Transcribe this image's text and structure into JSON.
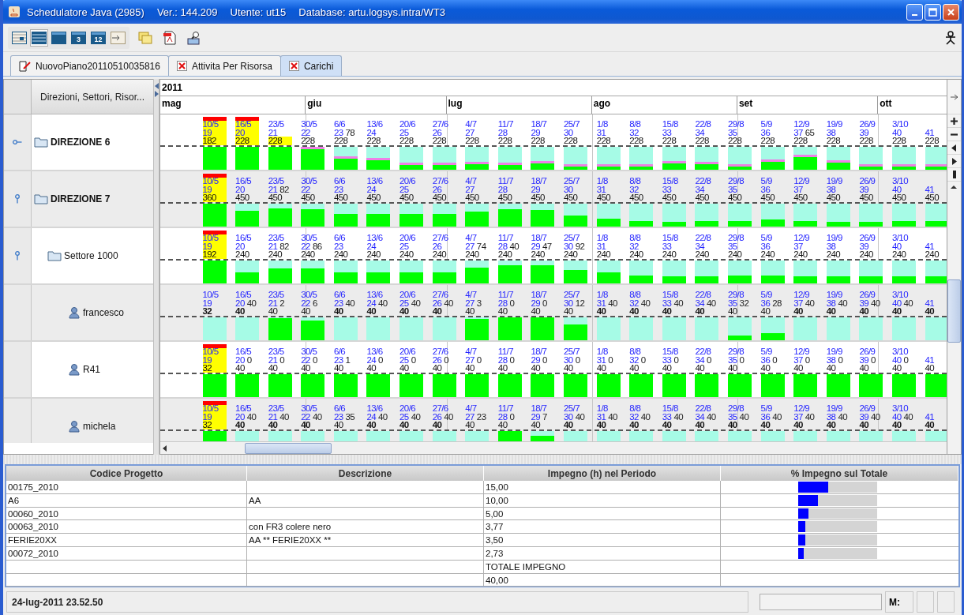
{
  "window": {
    "title_parts": [
      "Schedulatore Java (2985)",
      "Ver.: 144.209",
      "Utente: ut15",
      "Database: artu.logsys.intra/WT3"
    ]
  },
  "toolbar": {
    "view_buttons": [
      {
        "kind": "grid",
        "selected": false
      },
      {
        "kind": "rows",
        "selected": true
      },
      {
        "kind": "calendar",
        "selected": false
      },
      {
        "kind": "calendar",
        "label": "3",
        "selected": false
      },
      {
        "kind": "calendar",
        "label": "12",
        "selected": false
      },
      {
        "kind": "import",
        "selected": false
      }
    ],
    "tools": [
      {
        "kind": "notes"
      },
      {
        "kind": "pdf"
      },
      {
        "kind": "preview"
      }
    ]
  },
  "tabs": [
    {
      "label": "NuovoPiano20110510035816",
      "kind": "document",
      "selected": false
    },
    {
      "label": "Attivita Per Risorsa",
      "kind": "close",
      "selected": false
    },
    {
      "label": "Carichi",
      "kind": "close",
      "selected": true
    }
  ],
  "tree_header": "Direzioni, Settori, Risor...",
  "timeline": {
    "year": "2011",
    "months": [
      "mag",
      "giu",
      "lug",
      "ago",
      "set",
      "ott"
    ]
  },
  "rows": [
    {
      "label": "DIREZIONE 6",
      "kind": "direzione",
      "expanded": false,
      "cells": [
        {
          "date": "10/5",
          "week": "19",
          "capacity": "182",
          "bold": false,
          "overloaded": true,
          "warning": false,
          "marker": false
        },
        {
          "date": "16/5",
          "week": "20",
          "capacity": "228",
          "bold": false,
          "overloaded": true,
          "warning": false,
          "marker": false
        },
        {
          "date": "23/5",
          "week": "21",
          "capacity": "228",
          "bold": false,
          "overloaded": false,
          "warning": true,
          "marker": false
        },
        {
          "date": "30/5",
          "week": "22",
          "capacity": "228",
          "bold": false,
          "overloaded": false,
          "warning": false,
          "marker": true
        },
        {
          "date": "6/6",
          "week": "23",
          "load": "78",
          "capacity": "228",
          "bold": false,
          "overloaded": false,
          "warning": false,
          "marker": true
        },
        {
          "date": "13/6",
          "week": "24",
          "capacity": "228",
          "bold": false,
          "overloaded": false,
          "warning": false,
          "marker": true
        },
        {
          "date": "20/6",
          "week": "25",
          "capacity": "228",
          "bold": false,
          "overloaded": false,
          "warning": false,
          "marker": true
        },
        {
          "date": "27/6",
          "week": "26",
          "capacity": "228",
          "bold": false,
          "overloaded": false,
          "warning": false,
          "marker": true
        },
        {
          "date": "4/7",
          "week": "27",
          "capacity": "228",
          "bold": false,
          "overloaded": false,
          "warning": false,
          "marker": true
        },
        {
          "date": "11/7",
          "week": "28",
          "capacity": "228",
          "bold": false,
          "overloaded": false,
          "warning": false,
          "marker": true
        },
        {
          "date": "18/7",
          "week": "29",
          "capacity": "228",
          "bold": false,
          "overloaded": false,
          "warning": false,
          "marker": true
        },
        {
          "date": "25/7",
          "week": "30",
          "capacity": "228",
          "bold": false,
          "overloaded": false,
          "warning": false,
          "marker": true
        },
        {
          "date": "1/8",
          "week": "31",
          "capacity": "228",
          "bold": false,
          "overloaded": false,
          "warning": false,
          "marker": true
        },
        {
          "date": "8/8",
          "week": "32",
          "capacity": "228",
          "bold": false,
          "overloaded": false,
          "warning": false,
          "marker": true
        },
        {
          "date": "15/8",
          "week": "33",
          "capacity": "228",
          "bold": false,
          "overloaded": false,
          "warning": false,
          "marker": true
        },
        {
          "date": "22/8",
          "week": "34",
          "capacity": "228",
          "bold": false,
          "overloaded": false,
          "warning": false,
          "marker": true
        },
        {
          "date": "29/8",
          "week": "35",
          "capacity": "228",
          "bold": false,
          "overloaded": false,
          "warning": false,
          "marker": true
        },
        {
          "date": "5/9",
          "week": "36",
          "capacity": "228",
          "bold": false,
          "overloaded": false,
          "warning": false,
          "marker": true
        },
        {
          "date": "12/9",
          "week": "37",
          "load": "65",
          "capacity": "228",
          "bold": false,
          "overloaded": false,
          "warning": false,
          "marker": true
        },
        {
          "date": "19/9",
          "week": "38",
          "capacity": "228",
          "bold": false,
          "overloaded": false,
          "warning": false,
          "marker": true
        },
        {
          "date": "26/9",
          "week": "39",
          "capacity": "228",
          "bold": false,
          "overloaded": false,
          "warning": false,
          "marker": true
        },
        {
          "date": "3/10",
          "week": "40",
          "capacity": "228",
          "bold": false,
          "overloaded": false,
          "warning": false,
          "marker": true
        },
        {
          "week": "41",
          "capacity": "228",
          "bold": false,
          "overloaded": false,
          "warning": false,
          "marker": true
        }
      ]
    },
    {
      "label": "DIREZIONE 7",
      "kind": "direzione",
      "expanded": true,
      "cells": [
        {
          "date": "10/5",
          "week": "19",
          "capacity": "360",
          "bold": false,
          "overloaded": true,
          "warning": false,
          "marker": false
        },
        {
          "date": "16/5",
          "week": "20",
          "capacity": "450",
          "bold": false,
          "overloaded": false,
          "warning": false,
          "marker": false
        },
        {
          "date": "23/5",
          "week": "21",
          "load": "82",
          "capacity": "450",
          "bold": false,
          "overloaded": false,
          "warning": false,
          "marker": false
        },
        {
          "date": "30/5",
          "week": "22",
          "capacity": "450",
          "bold": false,
          "overloaded": false,
          "warning": false,
          "marker": false
        },
        {
          "date": "6/6",
          "week": "23",
          "capacity": "450",
          "bold": false,
          "overloaded": false,
          "warning": false,
          "marker": false
        },
        {
          "date": "13/6",
          "week": "24",
          "capacity": "450",
          "bold": false,
          "overloaded": false,
          "warning": false,
          "marker": false
        },
        {
          "date": "20/6",
          "week": "25",
          "capacity": "450",
          "bold": false,
          "overloaded": false,
          "warning": false,
          "marker": false
        },
        {
          "date": "27/6",
          "week": "26",
          "capacity": "450",
          "bold": false,
          "overloaded": false,
          "warning": false,
          "marker": false
        },
        {
          "date": "4/7",
          "week": "27",
          "capacity": "450",
          "bold": false,
          "overloaded": false,
          "warning": false,
          "marker": false
        },
        {
          "date": "11/7",
          "week": "28",
          "capacity": "450",
          "bold": false,
          "overloaded": false,
          "warning": false,
          "marker": false
        },
        {
          "date": "18/7",
          "week": "29",
          "capacity": "450",
          "bold": false,
          "overloaded": false,
          "warning": false,
          "marker": false
        },
        {
          "date": "25/7",
          "week": "30",
          "capacity": "450",
          "bold": false,
          "overloaded": false,
          "warning": false,
          "marker": false
        },
        {
          "date": "1/8",
          "week": "31",
          "capacity": "450",
          "bold": false,
          "overloaded": false,
          "warning": false,
          "marker": false
        },
        {
          "date": "8/8",
          "week": "32",
          "capacity": "450",
          "bold": false,
          "overloaded": false,
          "warning": false,
          "marker": false
        },
        {
          "date": "15/8",
          "week": "33",
          "capacity": "450",
          "bold": false,
          "overloaded": false,
          "warning": false,
          "marker": false
        },
        {
          "date": "22/8",
          "week": "34",
          "capacity": "450",
          "bold": false,
          "overloaded": false,
          "warning": false,
          "marker": false
        },
        {
          "date": "29/8",
          "week": "35",
          "capacity": "450",
          "bold": false,
          "overloaded": false,
          "warning": false,
          "marker": false
        },
        {
          "date": "5/9",
          "week": "36",
          "capacity": "450",
          "bold": false,
          "overloaded": false,
          "warning": false,
          "marker": false
        },
        {
          "date": "12/9",
          "week": "37",
          "capacity": "450",
          "bold": false,
          "overloaded": false,
          "warning": false,
          "marker": false
        },
        {
          "date": "19/9",
          "week": "38",
          "capacity": "450",
          "bold": false,
          "overloaded": false,
          "warning": false,
          "marker": false
        },
        {
          "date": "26/9",
          "week": "39",
          "capacity": "450",
          "bold": false,
          "overloaded": false,
          "warning": false,
          "marker": false
        },
        {
          "date": "3/10",
          "week": "40",
          "capacity": "450",
          "bold": false,
          "overloaded": false,
          "warning": false,
          "marker": false
        },
        {
          "week": "41",
          "capacity": "450",
          "bold": false,
          "overloaded": false,
          "warning": false,
          "marker": false
        }
      ],
      "children": [
        {
          "label": "Settore 1000",
          "kind": "settore",
          "expanded": true,
          "cells": [
            {
              "date": "10/5",
              "week": "19",
              "capacity": "192",
              "bold": false,
              "overloaded": true,
              "warning": false,
              "marker": false
            },
            {
              "date": "16/5",
              "week": "20",
              "capacity": "240",
              "bold": false,
              "overloaded": false,
              "warning": false,
              "marker": false
            },
            {
              "date": "23/5",
              "week": "21",
              "load": "82",
              "capacity": "240",
              "bold": false,
              "overloaded": false,
              "warning": false,
              "marker": false
            },
            {
              "date": "30/5",
              "week": "22",
              "load": "86",
              "capacity": "240",
              "bold": false,
              "overloaded": false,
              "warning": false,
              "marker": false
            },
            {
              "date": "6/6",
              "week": "23",
              "capacity": "240",
              "bold": false,
              "overloaded": false,
              "warning": false,
              "marker": false
            },
            {
              "date": "13/6",
              "week": "24",
              "capacity": "240",
              "bold": false,
              "overloaded": false,
              "warning": false,
              "marker": false
            },
            {
              "date": "20/6",
              "week": "25",
              "capacity": "240",
              "bold": false,
              "overloaded": false,
              "warning": false,
              "marker": false
            },
            {
              "date": "27/6",
              "week": "26",
              "capacity": "240",
              "bold": false,
              "overloaded": false,
              "warning": false,
              "marker": false
            },
            {
              "date": "4/7",
              "week": "27",
              "load": "74",
              "capacity": "240",
              "bold": false,
              "overloaded": false,
              "warning": false,
              "marker": false
            },
            {
              "date": "11/7",
              "week": "28",
              "load": "40",
              "capacity": "240",
              "bold": false,
              "overloaded": false,
              "warning": false,
              "marker": false
            },
            {
              "date": "18/7",
              "week": "29",
              "load": "47",
              "capacity": "240",
              "bold": false,
              "overloaded": false,
              "warning": false,
              "marker": false
            },
            {
              "date": "25/7",
              "week": "30",
              "load": "92",
              "capacity": "240",
              "bold": false,
              "overloaded": false,
              "warning": false,
              "marker": false
            },
            {
              "date": "1/8",
              "week": "31",
              "capacity": "240",
              "bold": false,
              "overloaded": false,
              "warning": false,
              "marker": false
            },
            {
              "date": "8/8",
              "week": "32",
              "capacity": "240",
              "bold": false,
              "overloaded": false,
              "warning": false,
              "marker": false
            },
            {
              "date": "15/8",
              "week": "33",
              "capacity": "240",
              "bold": false,
              "overloaded": false,
              "warning": false,
              "marker": false
            },
            {
              "date": "22/8",
              "week": "34",
              "capacity": "240",
              "bold": false,
              "overloaded": false,
              "warning": false,
              "marker": false
            },
            {
              "date": "29/8",
              "week": "35",
              "capacity": "240",
              "bold": false,
              "overloaded": false,
              "warning": false,
              "marker": false
            },
            {
              "date": "5/9",
              "week": "36",
              "capacity": "240",
              "bold": false,
              "overloaded": false,
              "warning": false,
              "marker": false
            },
            {
              "date": "12/9",
              "week": "37",
              "capacity": "240",
              "bold": false,
              "overloaded": false,
              "warning": false,
              "marker": false
            },
            {
              "date": "19/9",
              "week": "38",
              "capacity": "240",
              "bold": false,
              "overloaded": false,
              "warning": false,
              "marker": false
            },
            {
              "date": "26/9",
              "week": "39",
              "capacity": "240",
              "bold": false,
              "overloaded": false,
              "warning": false,
              "marker": false
            },
            {
              "date": "3/10",
              "week": "40",
              "capacity": "240",
              "bold": false,
              "overloaded": false,
              "warning": false,
              "marker": false
            },
            {
              "week": "41",
              "capacity": "240",
              "bold": false,
              "overloaded": false,
              "warning": false,
              "marker": false
            }
          ],
          "children": [
            {
              "label": "francesco",
              "kind": "risorsa",
              "cells": [
                {
                  "date": "10/5",
                  "week": "19",
                  "capacity": "32",
                  "bold": true,
                  "overloaded": false,
                  "warning": false,
                  "marker": false
                },
                {
                  "date": "16/5",
                  "week": "20",
                  "load": "40",
                  "capacity": "40",
                  "bold": true,
                  "overloaded": false,
                  "warning": false,
                  "marker": false
                },
                {
                  "date": "23/5",
                  "week": "21",
                  "load": "2",
                  "capacity": "40",
                  "bold": false,
                  "overloaded": false,
                  "warning": false,
                  "marker": false
                },
                {
                  "date": "30/5",
                  "week": "22",
                  "load": "6",
                  "capacity": "40",
                  "bold": false,
                  "overloaded": false,
                  "warning": false,
                  "marker": false
                },
                {
                  "date": "6/6",
                  "week": "23",
                  "load": "40",
                  "capacity": "40",
                  "bold": true,
                  "overloaded": false,
                  "warning": false,
                  "marker": false
                },
                {
                  "date": "13/6",
                  "week": "24",
                  "load": "40",
                  "capacity": "40",
                  "bold": true,
                  "overloaded": false,
                  "warning": false,
                  "marker": false
                },
                {
                  "date": "20/6",
                  "week": "25",
                  "load": "40",
                  "capacity": "40",
                  "bold": true,
                  "overloaded": false,
                  "warning": false,
                  "marker": false
                },
                {
                  "date": "27/6",
                  "week": "26",
                  "load": "40",
                  "capacity": "40",
                  "bold": true,
                  "overloaded": false,
                  "warning": false,
                  "marker": false
                },
                {
                  "date": "4/7",
                  "week": "27",
                  "load": "3",
                  "capacity": "40",
                  "bold": false,
                  "overloaded": false,
                  "warning": false,
                  "marker": false
                },
                {
                  "date": "11/7",
                  "week": "28",
                  "load": "0",
                  "capacity": "40",
                  "bold": false,
                  "overloaded": false,
                  "warning": false,
                  "marker": false
                },
                {
                  "date": "18/7",
                  "week": "29",
                  "load": "0",
                  "capacity": "40",
                  "bold": false,
                  "overloaded": false,
                  "warning": false,
                  "marker": false
                },
                {
                  "date": "25/7",
                  "week": "30",
                  "load": "12",
                  "capacity": "40",
                  "bold": false,
                  "overloaded": false,
                  "warning": false,
                  "marker": false
                },
                {
                  "date": "1/8",
                  "week": "31",
                  "load": "40",
                  "capacity": "40",
                  "bold": true,
                  "overloaded": false,
                  "warning": false,
                  "marker": false
                },
                {
                  "date": "8/8",
                  "week": "32",
                  "load": "40",
                  "capacity": "40",
                  "bold": true,
                  "overloaded": false,
                  "warning": false,
                  "marker": false
                },
                {
                  "date": "15/8",
                  "week": "33",
                  "load": "40",
                  "capacity": "40",
                  "bold": true,
                  "overloaded": false,
                  "warning": false,
                  "marker": false
                },
                {
                  "date": "22/8",
                  "week": "34",
                  "load": "40",
                  "capacity": "40",
                  "bold": true,
                  "overloaded": false,
                  "warning": false,
                  "marker": false
                },
                {
                  "date": "29/8",
                  "week": "35",
                  "load": "32",
                  "capacity": "40",
                  "bold": false,
                  "overloaded": false,
                  "warning": false,
                  "marker": false
                },
                {
                  "date": "5/9",
                  "week": "36",
                  "load": "28",
                  "capacity": "40",
                  "bold": false,
                  "overloaded": false,
                  "warning": false,
                  "marker": false
                },
                {
                  "date": "12/9",
                  "week": "37",
                  "load": "40",
                  "capacity": "40",
                  "bold": true,
                  "overloaded": false,
                  "warning": false,
                  "marker": false
                },
                {
                  "date": "19/9",
                  "week": "38",
                  "load": "40",
                  "capacity": "40",
                  "bold": true,
                  "overloaded": false,
                  "warning": false,
                  "marker": false
                },
                {
                  "date": "26/9",
                  "week": "39",
                  "load": "40",
                  "capacity": "40",
                  "bold": true,
                  "overloaded": false,
                  "warning": false,
                  "marker": false
                },
                {
                  "date": "3/10",
                  "week": "40",
                  "load": "40",
                  "capacity": "40",
                  "bold": true,
                  "overloaded": false,
                  "warning": false,
                  "marker": false
                },
                {
                  "week": "41",
                  "capacity": "40",
                  "bold": true,
                  "overloaded": false,
                  "warning": false,
                  "marker": false
                }
              ]
            },
            {
              "label": "R41",
              "kind": "risorsa",
              "cells": [
                {
                  "date": "10/5",
                  "week": "19",
                  "capacity": "32",
                  "bold": false,
                  "overloaded": true,
                  "warning": false,
                  "marker": false
                },
                {
                  "date": "16/5",
                  "week": "20",
                  "load": "0",
                  "capacity": "40",
                  "bold": false,
                  "overloaded": false,
                  "warning": false,
                  "marker": false
                },
                {
                  "date": "23/5",
                  "week": "21",
                  "load": "0",
                  "capacity": "40",
                  "bold": false,
                  "overloaded": false,
                  "warning": false,
                  "marker": false
                },
                {
                  "date": "30/5",
                  "week": "22",
                  "load": "0",
                  "capacity": "40",
                  "bold": false,
                  "overloaded": false,
                  "warning": false,
                  "marker": false
                },
                {
                  "date": "6/6",
                  "week": "23",
                  "load": "1",
                  "capacity": "40",
                  "bold": false,
                  "overloaded": false,
                  "warning": false,
                  "marker": false
                },
                {
                  "date": "13/6",
                  "week": "24",
                  "load": "0",
                  "capacity": "40",
                  "bold": false,
                  "overloaded": false,
                  "warning": false,
                  "marker": false
                },
                {
                  "date": "20/6",
                  "week": "25",
                  "load": "0",
                  "capacity": "40",
                  "bold": false,
                  "overloaded": false,
                  "warning": false,
                  "marker": false
                },
                {
                  "date": "27/6",
                  "week": "26",
                  "load": "0",
                  "capacity": "40",
                  "bold": false,
                  "overloaded": false,
                  "warning": false,
                  "marker": false
                },
                {
                  "date": "4/7",
                  "week": "27",
                  "load": "0",
                  "capacity": "40",
                  "bold": false,
                  "overloaded": false,
                  "warning": false,
                  "marker": false
                },
                {
                  "date": "11/7",
                  "week": "28",
                  "load": "0",
                  "capacity": "40",
                  "bold": false,
                  "overloaded": false,
                  "warning": false,
                  "marker": false
                },
                {
                  "date": "18/7",
                  "week": "29",
                  "load": "0",
                  "capacity": "40",
                  "bold": false,
                  "overloaded": false,
                  "warning": false,
                  "marker": false
                },
                {
                  "date": "25/7",
                  "week": "30",
                  "load": "0",
                  "capacity": "40",
                  "bold": false,
                  "overloaded": false,
                  "warning": false,
                  "marker": false
                },
                {
                  "date": "1/8",
                  "week": "31",
                  "load": "0",
                  "capacity": "40",
                  "bold": false,
                  "overloaded": false,
                  "warning": false,
                  "marker": false
                },
                {
                  "date": "8/8",
                  "week": "32",
                  "load": "0",
                  "capacity": "40",
                  "bold": false,
                  "overloaded": false,
                  "warning": false,
                  "marker": false
                },
                {
                  "date": "15/8",
                  "week": "33",
                  "load": "0",
                  "capacity": "40",
                  "bold": false,
                  "overloaded": false,
                  "warning": false,
                  "marker": false
                },
                {
                  "date": "22/8",
                  "week": "34",
                  "load": "0",
                  "capacity": "40",
                  "bold": false,
                  "overloaded": false,
                  "warning": false,
                  "marker": false
                },
                {
                  "date": "29/8",
                  "week": "35",
                  "load": "0",
                  "capacity": "40",
                  "bold": false,
                  "overloaded": false,
                  "warning": false,
                  "marker": false
                },
                {
                  "date": "5/9",
                  "week": "36",
                  "load": "0",
                  "capacity": "40",
                  "bold": false,
                  "overloaded": false,
                  "warning": false,
                  "marker": false
                },
                {
                  "date": "12/9",
                  "week": "37",
                  "load": "0",
                  "capacity": "40",
                  "bold": false,
                  "overloaded": false,
                  "warning": false,
                  "marker": false
                },
                {
                  "date": "19/9",
                  "week": "38",
                  "load": "0",
                  "capacity": "40",
                  "bold": false,
                  "overloaded": false,
                  "warning": false,
                  "marker": false
                },
                {
                  "date": "26/9",
                  "week": "39",
                  "load": "0",
                  "capacity": "40",
                  "bold": false,
                  "overloaded": false,
                  "warning": false,
                  "marker": false
                },
                {
                  "date": "3/10",
                  "week": "40",
                  "load": "0",
                  "capacity": "40",
                  "bold": false,
                  "overloaded": false,
                  "warning": false,
                  "marker": false
                },
                {
                  "week": "41",
                  "capacity": "40",
                  "bold": false,
                  "overloaded": false,
                  "warning": false,
                  "marker": false
                }
              ]
            },
            {
              "label": "michela",
              "kind": "risorsa",
              "cells": [
                {
                  "date": "10/5",
                  "week": "19",
                  "capacity": "32",
                  "bold": false,
                  "overloaded": true,
                  "warning": false,
                  "marker": false
                },
                {
                  "date": "16/5",
                  "week": "20",
                  "load": "40",
                  "capacity": "40",
                  "bold": true,
                  "overloaded": false,
                  "warning": false,
                  "marker": false
                },
                {
                  "date": "23/5",
                  "week": "21",
                  "load": "40",
                  "capacity": "40",
                  "bold": true,
                  "overloaded": false,
                  "warning": false,
                  "marker": false
                },
                {
                  "date": "30/5",
                  "week": "22",
                  "load": "40",
                  "capacity": "40",
                  "bold": true,
                  "overloaded": false,
                  "warning": false,
                  "marker": false
                },
                {
                  "date": "6/6",
                  "week": "23",
                  "load": "35",
                  "capacity": "40",
                  "bold": false,
                  "overloaded": false,
                  "warning": false,
                  "marker": false
                },
                {
                  "date": "13/6",
                  "week": "24",
                  "load": "40",
                  "capacity": "40",
                  "bold": true,
                  "overloaded": false,
                  "warning": false,
                  "marker": false
                },
                {
                  "date": "20/6",
                  "week": "25",
                  "load": "40",
                  "capacity": "40",
                  "bold": true,
                  "overloaded": false,
                  "warning": false,
                  "marker": false
                },
                {
                  "date": "27/6",
                  "week": "26",
                  "load": "40",
                  "capacity": "40",
                  "bold": true,
                  "overloaded": false,
                  "warning": false,
                  "marker": false
                },
                {
                  "date": "4/7",
                  "week": "27",
                  "load": "23",
                  "capacity": "40",
                  "bold": false,
                  "overloaded": false,
                  "warning": false,
                  "marker": false
                },
                {
                  "date": "11/7",
                  "week": "28",
                  "load": "0",
                  "capacity": "40",
                  "bold": false,
                  "overloaded": false,
                  "warning": false,
                  "marker": false
                },
                {
                  "date": "18/7",
                  "week": "29",
                  "load": "7",
                  "capacity": "40",
                  "bold": false,
                  "overloaded": false,
                  "warning": false,
                  "marker": false
                },
                {
                  "date": "25/7",
                  "week": "30",
                  "load": "40",
                  "capacity": "40",
                  "bold": true,
                  "overloaded": false,
                  "warning": false,
                  "marker": false
                },
                {
                  "date": "1/8",
                  "week": "31",
                  "load": "40",
                  "capacity": "40",
                  "bold": true,
                  "overloaded": false,
                  "warning": false,
                  "marker": false
                },
                {
                  "date": "8/8",
                  "week": "32",
                  "load": "40",
                  "capacity": "40",
                  "bold": true,
                  "overloaded": false,
                  "warning": false,
                  "marker": false
                },
                {
                  "date": "15/8",
                  "week": "33",
                  "load": "40",
                  "capacity": "40",
                  "bold": true,
                  "overloaded": false,
                  "warning": false,
                  "marker": false
                },
                {
                  "date": "22/8",
                  "week": "34",
                  "load": "40",
                  "capacity": "40",
                  "bold": true,
                  "overloaded": false,
                  "warning": false,
                  "marker": false
                },
                {
                  "date": "29/8",
                  "week": "35",
                  "load": "40",
                  "capacity": "40",
                  "bold": true,
                  "overloaded": false,
                  "warning": false,
                  "marker": false
                },
                {
                  "date": "5/9",
                  "week": "36",
                  "load": "40",
                  "capacity": "40",
                  "bold": true,
                  "overloaded": false,
                  "warning": false,
                  "marker": false
                },
                {
                  "date": "12/9",
                  "week": "37",
                  "load": "40",
                  "capacity": "40",
                  "bold": true,
                  "overloaded": false,
                  "warning": false,
                  "marker": false
                },
                {
                  "date": "19/9",
                  "week": "38",
                  "load": "40",
                  "capacity": "40",
                  "bold": true,
                  "overloaded": false,
                  "warning": false,
                  "marker": false
                },
                {
                  "date": "26/9",
                  "week": "39",
                  "load": "40",
                  "capacity": "40",
                  "bold": true,
                  "overloaded": false,
                  "warning": false,
                  "marker": false
                },
                {
                  "date": "3/10",
                  "week": "40",
                  "load": "40",
                  "capacity": "40",
                  "bold": true,
                  "overloaded": false,
                  "warning": false,
                  "marker": false
                },
                {
                  "week": "41",
                  "capacity": "40",
                  "bold": true,
                  "overloaded": false,
                  "warning": false,
                  "marker": false
                }
              ]
            }
          ]
        }
      ]
    }
  ],
  "table": {
    "columns": [
      "Codice Progetto",
      "Descrizione",
      "Impegno (h) nel Periodo",
      "% Impegno sul Totale"
    ],
    "rows": [
      {
        "code": "00175_2010",
        "hours": "15,00",
        "level": 0.375
      },
      {
        "code": "A6",
        "description": "AA",
        "hours": "10,00",
        "level": 0.25
      },
      {
        "code": "00060_2010",
        "hours": "5,00",
        "level": 0.125
      },
      {
        "code": "00063_2010",
        "description": "con FR3 colere nero",
        "hours": "3,77",
        "level": 0.094
      },
      {
        "code": "FERIE20XX",
        "description": "AA ** FERIE20XX **",
        "hours": "3,50",
        "level": 0.0875
      },
      {
        "code": "00072_2010",
        "hours": "2,73",
        "level": 0.068
      }
    ],
    "footer": [
      "TOTALE IMPEGNO",
      "40,00"
    ]
  },
  "status_bar": {
    "datetime": "24-lug-2011 23.52.50",
    "memory_label": "M:"
  }
}
